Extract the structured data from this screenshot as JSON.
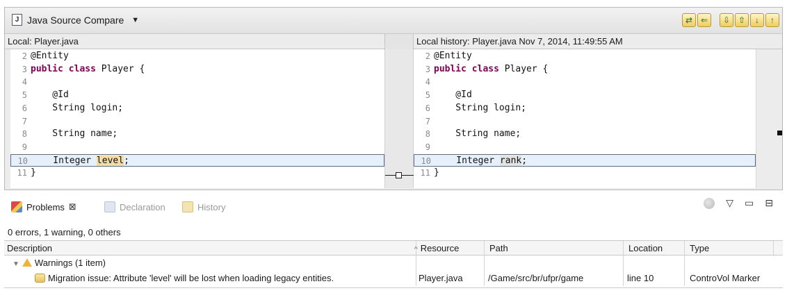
{
  "compare_viewer": {
    "title": "Java Source Compare",
    "file_icon": "J",
    "toolbar_icons": [
      "copy-all-left-to-right-icon",
      "copy-current-change-left-to-right-icon",
      "next-difference-icon",
      "previous-difference-icon",
      "next-change-icon",
      "previous-change-icon"
    ],
    "left_title": "Local: Player.java",
    "right_title": "Local history: Player.java Nov 7, 2014, 11:49:55 AM",
    "left_lines": [
      {
        "num": "2",
        "code": "@Entity"
      },
      {
        "num": "3",
        "kw": "public class",
        "code": " Player {"
      },
      {
        "num": "4",
        "code": ""
      },
      {
        "num": "5",
        "code": "    @Id"
      },
      {
        "num": "6",
        "code": "    String login;"
      },
      {
        "num": "7",
        "code": ""
      },
      {
        "num": "8",
        "code": "    String name;"
      },
      {
        "num": "9",
        "code": ""
      },
      {
        "num": "10",
        "code": "    Integer ",
        "highlight": "level",
        "rest": ";"
      },
      {
        "num": "11",
        "code": "}"
      }
    ],
    "right_lines": [
      {
        "num": "2",
        "code": "@Entity"
      },
      {
        "num": "3",
        "kw": "public class",
        "code": " Player {"
      },
      {
        "num": "4",
        "code": ""
      },
      {
        "num": "5",
        "code": "    @Id"
      },
      {
        "num": "6",
        "code": "    String login;"
      },
      {
        "num": "7",
        "code": ""
      },
      {
        "num": "8",
        "code": "    String name;"
      },
      {
        "num": "9",
        "code": ""
      },
      {
        "num": "10",
        "code": "    Integer ",
        "highlight": "rank",
        "rest": ";"
      },
      {
        "num": "11",
        "code": "}"
      }
    ]
  },
  "problems_view": {
    "tabs": [
      {
        "label": "Problems",
        "icon": "problems-icon",
        "active": true
      },
      {
        "label": "Declaration",
        "icon": "declaration-icon",
        "active": false
      },
      {
        "label": "History",
        "icon": "history-icon",
        "active": false
      }
    ],
    "close_tab_icon": "⊠",
    "view_actions": [
      "filter-icon",
      "view-menu-icon",
      "minimize-icon",
      "maximize-icon"
    ],
    "summary": "0 errors, 1 warning, 0 others",
    "columns": [
      "Description",
      "Resource",
      "Path",
      "Location",
      "Type"
    ],
    "group_row": "Warnings (1 item)",
    "warning": {
      "description": "Migration issue: Attribute 'level' will be lost when loading legacy entities.",
      "resource": "Player.java",
      "path": "/Game/src/br/ufpr/game",
      "location": "line 10",
      "type": "ControVol Marker"
    }
  },
  "colors": {
    "changed_line_bg": "#e6f0fb",
    "left_highlight": "#f5dca4",
    "right_highlight": "#e3e3e3",
    "keyword": "#7f0055",
    "warning": "#f0b43a"
  }
}
